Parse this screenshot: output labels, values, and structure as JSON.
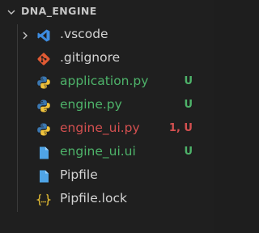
{
  "explorer": {
    "folder_title": "DNA_ENGINE",
    "items": [
      {
        "label": "vscode",
        "label_prefix": ".",
        "icon": "vscode-folder-icon",
        "type": "folder",
        "color": "#d4d4d4",
        "badge": "",
        "badge_color": ""
      },
      {
        "label": ".gitignore",
        "icon": "git-icon",
        "type": "file",
        "color": "#d4d4d4",
        "badge": "",
        "badge_color": ""
      },
      {
        "label": "application.py",
        "icon": "python-icon",
        "type": "file",
        "color": "#4eb36a",
        "badge": "U",
        "badge_color": "#4eb36a"
      },
      {
        "label": "engine.py",
        "icon": "python-icon",
        "type": "file",
        "color": "#4eb36a",
        "badge": "U",
        "badge_color": "#4eb36a"
      },
      {
        "label": "engine_ui.py",
        "icon": "python-icon",
        "type": "file",
        "color": "#d45050",
        "badge": "1, U",
        "badge_color": "#d45050"
      },
      {
        "label": "engine_ui.ui",
        "icon": "file-icon",
        "type": "file",
        "color": "#4eb36a",
        "badge": "U",
        "badge_color": "#4eb36a"
      },
      {
        "label": "Pipfile",
        "icon": "file-icon",
        "type": "file",
        "color": "#d4d4d4",
        "badge": "",
        "badge_color": ""
      },
      {
        "label": "Pipfile.lock",
        "icon": "json-braces-icon",
        "type": "file",
        "color": "#d4d4d4",
        "badge": "",
        "badge_color": ""
      }
    ]
  },
  "colors": {
    "background": "#1f1f1f",
    "git_untracked": "#4eb36a",
    "git_error": "#d45050",
    "python_blue": "#3b77b0",
    "python_yellow": "#f0c33c",
    "file_blue": "#4fa4e6",
    "vscode_blue": "#3d8ce0",
    "git_orange": "#e05a33",
    "json_yellow": "#d9b432"
  }
}
